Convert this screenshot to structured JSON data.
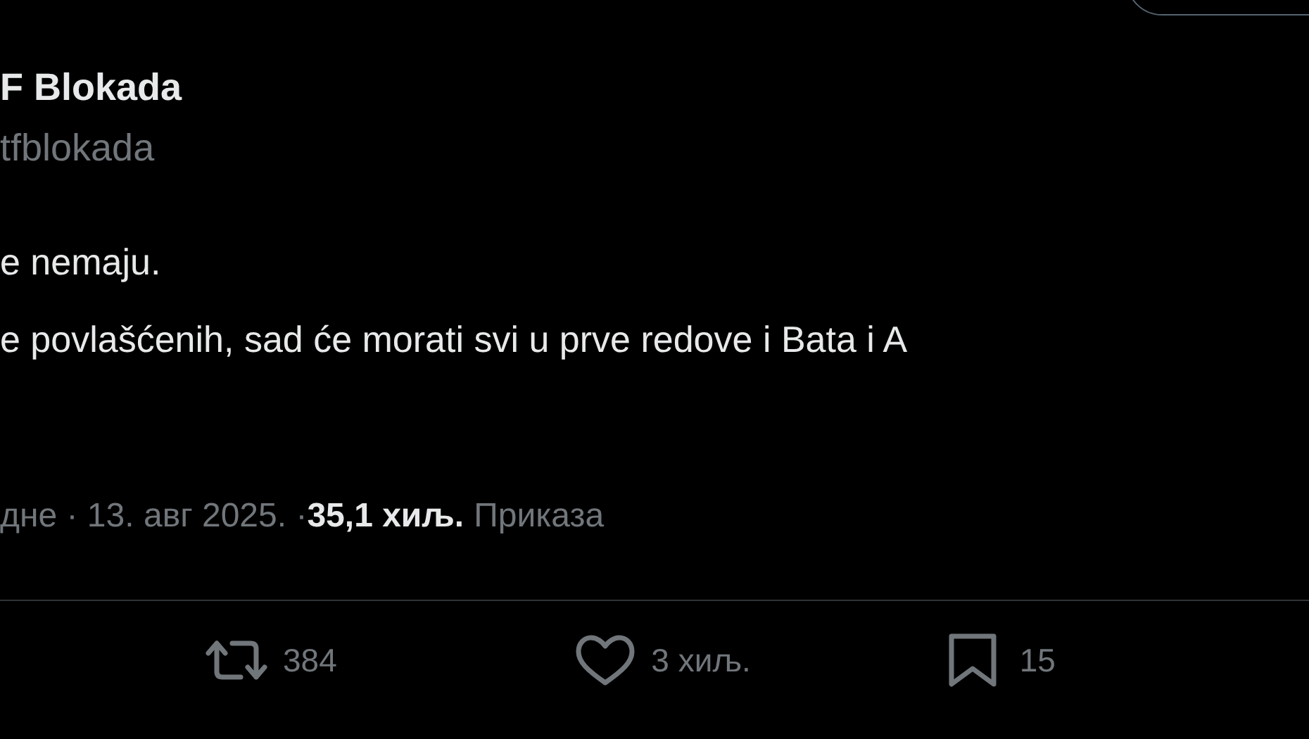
{
  "author": {
    "name": "F Blokada",
    "handle": "tfblokada"
  },
  "body": [
    "e nemaju.",
    "e povlašćenih, sad će morati svi u prve redove i Bata i A"
  ],
  "meta": {
    "time_date": "дне · 13. авг 2025. · ",
    "views": "35,1 хиљ.",
    "views_label": "Приказа"
  },
  "actions": [
    {
      "kind": "repost",
      "count": "384"
    },
    {
      "kind": "like",
      "count": "3 хиљ."
    },
    {
      "kind": "bookmark",
      "count": "15"
    }
  ]
}
